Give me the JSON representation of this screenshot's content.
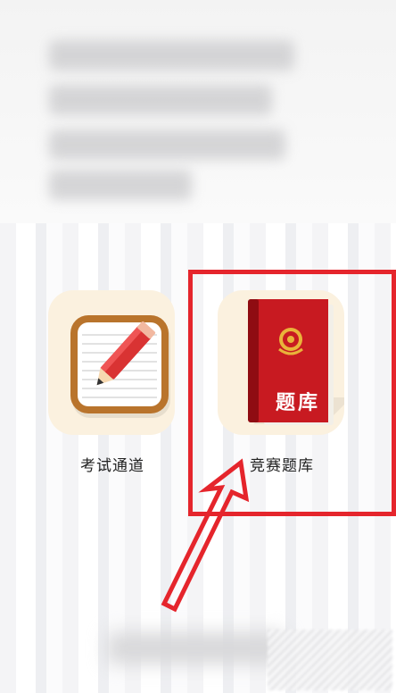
{
  "apps": [
    {
      "label": "考试通道",
      "icon": "notepad-pencil-icon"
    },
    {
      "label": "竞赛题库",
      "icon": "red-book-icon",
      "book_title": "题库"
    }
  ],
  "annotation": {
    "highlight_color": "#e5252c"
  }
}
